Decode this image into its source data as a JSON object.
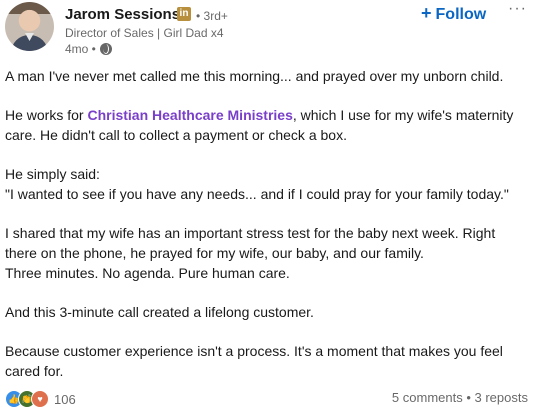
{
  "author": {
    "name": "Jarom Sessions",
    "badge": "in",
    "degree": "• 3rd+",
    "headline": "Director of Sales | Girl Dad x4",
    "time": "4mo •"
  },
  "actions": {
    "follow_label": "Follow",
    "follow_plus": "+",
    "more_label": "···"
  },
  "post": {
    "p1": "A man I've never met called me this morning... and prayed over my unborn child.",
    "p2_before": "He works for ",
    "p2_mention": "Christian Healthcare Ministries",
    "p2_after": ", which I use for my wife's maternity care. He didn't call to collect a payment or check a box.",
    "p3_a": "He simply said:",
    "p3_b": "\"I wanted to see if you have any needs... and if I could pray for your family today.\"",
    "p4_a": "I shared that my wife has an important stress test for the baby next week. Right there on the phone, he prayed for my wife, our baby, and our family.",
    "p4_b": "Three minutes. No agenda. Pure human care.",
    "p5": "And this 3-minute call created a lifelong customer.",
    "p6": "Because customer experience isn't a process. It's a moment that makes you feel cared for."
  },
  "footer": {
    "reaction_count": "106",
    "comments": "5 comments",
    "separator": " • ",
    "reposts": "3 reposts"
  },
  "colors": {
    "accent": "#0a66c2",
    "mention": "#7a3fc9",
    "badge": "#b78f3d"
  }
}
